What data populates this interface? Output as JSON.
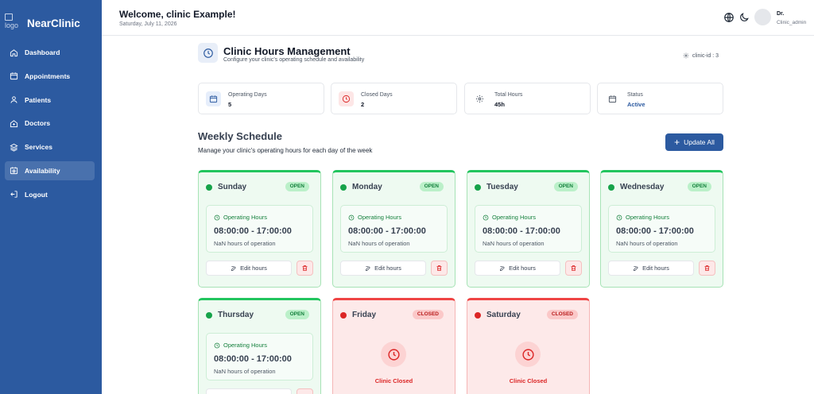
{
  "sidebar": {
    "logo_alt": "logo",
    "brand": "NearClinic",
    "items": [
      {
        "label": "Dashboard"
      },
      {
        "label": "Appointments"
      },
      {
        "label": "Patients"
      },
      {
        "label": "Doctors"
      },
      {
        "label": "Services"
      },
      {
        "label": "Availability"
      },
      {
        "label": "Logout"
      }
    ],
    "active": "Availability"
  },
  "header": {
    "welcome": "Welcome, clinic Example!",
    "date": "Saturday, July 11, 2026",
    "user_name": "Dr.",
    "user_role": "Clinic_admin"
  },
  "page": {
    "title": "Clinic Hours Management",
    "subtitle": "Configure your clinic's operating schedule and availability",
    "clinic_id": "clinic-id : 3"
  },
  "stats": [
    {
      "label": "Operating Days",
      "value": "5"
    },
    {
      "label": "Closed Days",
      "value": "2"
    },
    {
      "label": "Total Hours",
      "value": "45h"
    },
    {
      "label": "Status",
      "value": "Active"
    }
  ],
  "schedule": {
    "title": "Weekly Schedule",
    "subtitle": "Manage your clinic's operating hours for each day of the week",
    "update_all": "Update All",
    "days": [
      {
        "day": "Sunday",
        "status": "OPEN",
        "hours_label": "Operating Hours",
        "range": "08:00:00 - 17:00:00",
        "duration": "NaN hours of operation",
        "edit": "Edit hours"
      },
      {
        "day": "Monday",
        "status": "OPEN",
        "hours_label": "Operating Hours",
        "range": "08:00:00 - 17:00:00",
        "duration": "NaN hours of operation",
        "edit": "Edit hours"
      },
      {
        "day": "Tuesday",
        "status": "OPEN",
        "hours_label": "Operating Hours",
        "range": "08:00:00 - 17:00:00",
        "duration": "NaN hours of operation",
        "edit": "Edit hours"
      },
      {
        "day": "Wednesday",
        "status": "OPEN",
        "hours_label": "Operating Hours",
        "range": "08:00:00 - 17:00:00",
        "duration": "NaN hours of operation",
        "edit": "Edit hours"
      },
      {
        "day": "Thursday",
        "status": "OPEN",
        "hours_label": "Operating Hours",
        "range": "08:00:00 - 17:00:00",
        "duration": "NaN hours of operation"
      },
      {
        "day": "Friday",
        "status": "CLOSED",
        "closed_text": "Clinic Closed"
      },
      {
        "day": "Saturday",
        "status": "CLOSED",
        "closed_text": "Clinic Closed"
      }
    ]
  },
  "colors": {
    "brand": "#2c5aa0",
    "open": "#22c55e",
    "closed": "#ef4444"
  }
}
